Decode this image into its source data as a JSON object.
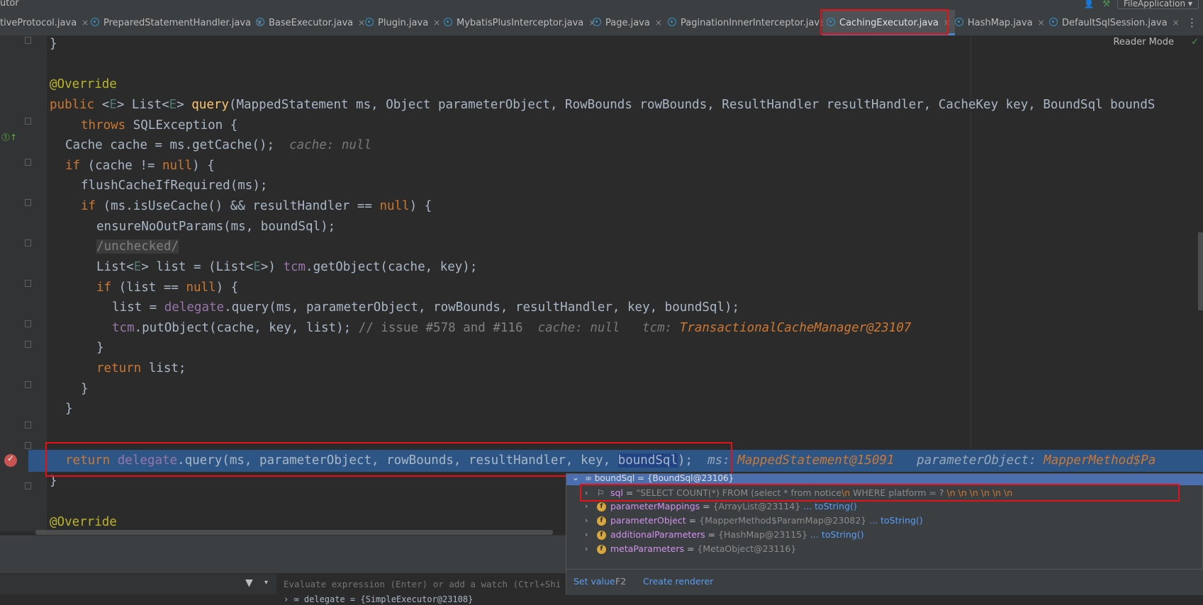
{
  "window": {
    "title_fragment": "utor",
    "run_config": "FileApplication",
    "run_config_arrow": "▾"
  },
  "tabs": [
    {
      "label": "tiveProtocol.java",
      "active": false
    },
    {
      "label": "PreparedStatementHandler.java",
      "active": false
    },
    {
      "label": "BaseExecutor.java",
      "active": false
    },
    {
      "label": "Plugin.java",
      "active": false
    },
    {
      "label": "MybatisPlusInterceptor.java",
      "active": false
    },
    {
      "label": "Page.java",
      "active": false
    },
    {
      "label": "PaginationInnerInterceptor.java",
      "active": false
    },
    {
      "label": "CachingExecutor.java",
      "active": true
    },
    {
      "label": "HashMap.java",
      "active": false
    },
    {
      "label": "DefaultSqlSession.java",
      "active": false
    }
  ],
  "tab_close_glyph": "×",
  "tab_more_glyph": "⋮",
  "editor": {
    "reader_mode": "Reader Mode",
    "check_glyph": "✓",
    "lines": {
      "l0": "}",
      "l2_annotation": "@Override",
      "l3": {
        "public": "public ",
        "generic_open": "<",
        "E": "E",
        "generic_close": "> List<",
        "E2": "E",
        "ret_close": "> ",
        "method": "query",
        "params": "(MappedStatement ms, Object parameterObject, RowBounds rowBounds, ResultHandler resultHandler, CacheKey key, BoundSql boundS"
      },
      "l4": {
        "throws": "throws",
        "rest": " SQLException {"
      },
      "l5": {
        "code": "Cache cache = ms.getCache();",
        "hint": "cache: null"
      },
      "l6": {
        "if": "if",
        "rest": " (cache != ",
        "null": "null",
        "end": ") {"
      },
      "l7": "flushCacheIfRequired(ms);",
      "l8": {
        "if": "if",
        "rest": " (ms.isUseCache() && resultHandler == ",
        "null": "null",
        "end": ") {"
      },
      "l9": "ensureNoOutParams(ms, boundSql);",
      "l10": "/unchecked/",
      "l11": {
        "a": "List<",
        "E": "E",
        "b": "> list = (List<",
        "E2": "E",
        "c": ">) ",
        "tcm": "tcm",
        "d": ".getObject(cache, key);"
      },
      "l12": {
        "if": "if",
        "rest": " (list == ",
        "null": "null",
        "end": ") {"
      },
      "l13": {
        "a": "list = ",
        "delegate": "delegate",
        "b": ".query(ms, parameterObject, rowBounds, resultHandler, key, boundSql);"
      },
      "l14": {
        "tcm": "tcm",
        "b": ".putObject(cache, key, list);",
        "comment": " // issue #578 and #116",
        "hint1": "cache: null",
        "hint2": "tcm:",
        "hint2_val": "TransactionalCacheManager@23107"
      },
      "l15": "}",
      "l16": {
        "return": "return",
        "rest": " list;"
      },
      "l17": "}",
      "l18": "}",
      "l19": {
        "return": "return",
        "delegate": "delegate",
        "a": ".query(ms, parameterObject, rowBounds, resultHandler, key, ",
        "boundSql": "boundSql",
        "b": ");",
        "hint1": "ms:",
        "hint1_val": "MappedStatement@15091",
        "hint2": "parameterObject:",
        "hint2_val": "MapperMethod$Pa"
      },
      "l20": "}",
      "l22_annotation": "@Override"
    }
  },
  "watch": {
    "placeholder": "Evaluate expression (Enter) or add a watch (Ctrl+Shift+Enter)",
    "filter_glyph": "▼",
    "dropdown_glyph": "▾"
  },
  "variables": {
    "delegate_row": "› ∞ delegate = {SimpleExecutor@23108}"
  },
  "popup": {
    "header": "∞ boundSql = {BoundSql@23106}",
    "header_arrow": "⌄",
    "rows": [
      {
        "name": "sql",
        "eq": " = ",
        "value": "\"SELECT COUNT(*) FROM (select * from notice",
        "value_b": "        WHERE  platform = ?",
        "tail": "          \\n           \\n           \\n           \\n           \\n           \\n",
        "esc": "\\n"
      },
      {
        "name": "parameterMappings",
        "eq": " = ",
        "value": "{ArrayList@23114}",
        "link": " ... toString()"
      },
      {
        "name": "parameterObject",
        "eq": " = ",
        "value": "{MapperMethod$ParamMap@23082}",
        "link": " ... toString()"
      },
      {
        "name": "additionalParameters",
        "eq": " = ",
        "value": "{HashMap@23115}",
        "link": " ... toString()"
      },
      {
        "name": "metaParameters",
        "eq": " = ",
        "value": "{MetaObject@23116}",
        "link": ""
      }
    ],
    "row_arrow": "›",
    "field_icon": "f",
    "flag_icon": "⚐",
    "set_value": "Set value",
    "set_value_key": "F2",
    "create_renderer": "Create renderer"
  }
}
